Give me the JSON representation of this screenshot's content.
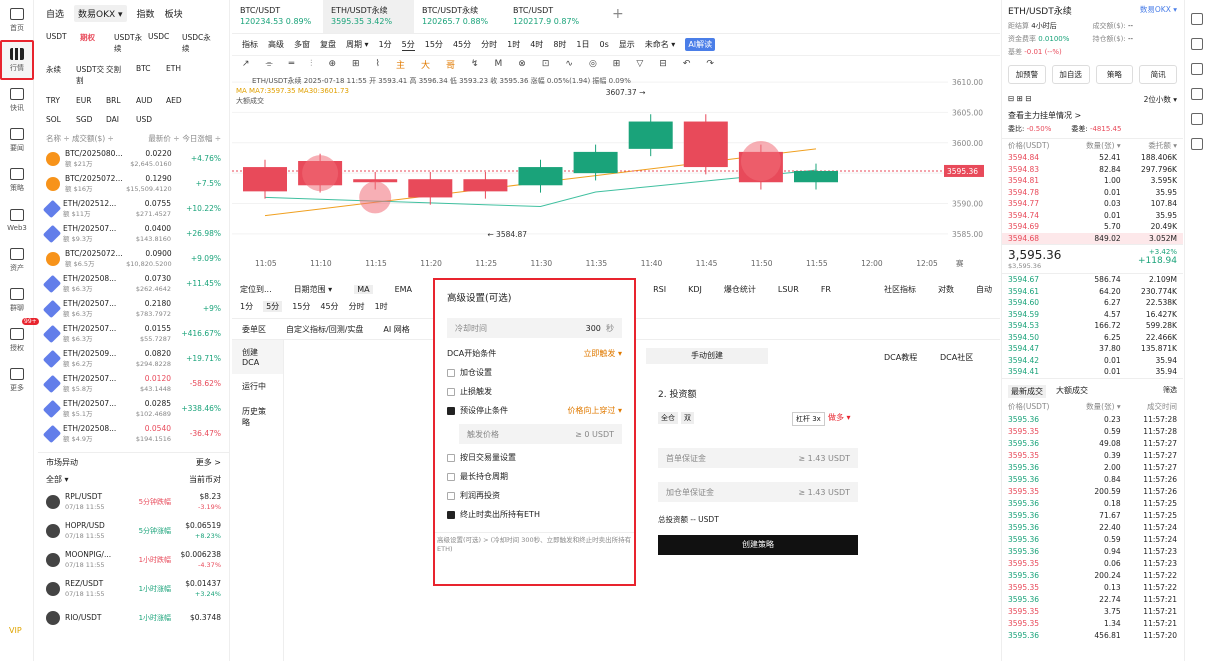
{
  "nav": [
    {
      "label": "首页"
    },
    {
      "label": "行情"
    },
    {
      "label": "快讯"
    },
    {
      "label": "要闻"
    },
    {
      "label": "策略"
    },
    {
      "label": "Web3"
    },
    {
      "label": "资产"
    },
    {
      "label": "群聊"
    },
    {
      "label": "授权"
    },
    {
      "label": "更多"
    }
  ],
  "nav_vip": "VIP",
  "nav_badge": "99+",
  "market": {
    "tabs": [
      "自选",
      "数易OKX ▾",
      "指数",
      "板块"
    ],
    "chips": [
      "USDT",
      "期权",
      "USDT永续",
      "USDC",
      "USDC永续",
      "永续",
      "USDT交割",
      "交割",
      "BTC",
      "ETH",
      "TRY",
      "EUR",
      "BRL",
      "AUD",
      "AED",
      "SOL",
      "SGD",
      "DAI",
      "USD"
    ],
    "cols": [
      "名称 ÷ 成交额($) ÷",
      "最新价 ÷",
      "今日涨幅 ÷"
    ],
    "rows": [
      {
        "n": "BTC/2025080...",
        "v": "额 $21万",
        "p": "0.0220",
        "p2": "$2,645.0160",
        "c": "+4.76%",
        "coin": "btc"
      },
      {
        "n": "BTC/2025072...",
        "v": "额 $16万",
        "p": "0.1290",
        "p2": "$15,509.4120",
        "c": "+7.5%",
        "coin": "btc"
      },
      {
        "n": "ETH/202512...",
        "v": "额 $11万",
        "p": "0.0755",
        "p2": "$271.4527",
        "c": "+10.22%",
        "coin": "eth"
      },
      {
        "n": "ETH/202507...",
        "v": "额 $9.3万",
        "p": "0.0400",
        "p2": "$143.8160",
        "c": "+26.98%",
        "coin": "eth"
      },
      {
        "n": "BTC/2025072...",
        "v": "额 $6.5万",
        "p": "0.0900",
        "p2": "$10,820.5200",
        "c": "+9.09%",
        "coin": "btc"
      },
      {
        "n": "ETH/202508...",
        "v": "额 $6.3万",
        "p": "0.0730",
        "p2": "$262.4642",
        "c": "+11.45%",
        "coin": "eth"
      },
      {
        "n": "ETH/202507...",
        "v": "额 $6.3万",
        "p": "0.2180",
        "p2": "$783.7972",
        "c": "+9%",
        "coin": "eth"
      },
      {
        "n": "ETH/202507...",
        "v": "额 $6.3万",
        "p": "0.0155",
        "p2": "$55.7287",
        "c": "+416.67%",
        "coin": "eth"
      },
      {
        "n": "ETH/202509...",
        "v": "额 $6.2万",
        "p": "0.0820",
        "p2": "$294.8228",
        "c": "+19.71%",
        "coin": "eth"
      },
      {
        "n": "ETH/202507...",
        "v": "额 $5.8万",
        "p": "0.0120",
        "p2": "$43.1448",
        "c": "-58.62%",
        "coin": "eth"
      },
      {
        "n": "ETH/202507...",
        "v": "额 $5.1万",
        "p": "0.0285",
        "p2": "$102.4689",
        "c": "+338.46%",
        "coin": "eth"
      },
      {
        "n": "ETH/202508...",
        "v": "额 $4.9万",
        "p": "0.0540",
        "p2": "$194.1516",
        "c": "-36.47%",
        "coin": "eth"
      }
    ],
    "movers_title": "市场异动",
    "movers_more": "更多 >",
    "movers_filter": "全部 ▾",
    "movers_cur": "当前币对",
    "movers": [
      {
        "n": "RPL/USDT",
        "t": "07/18 11:55",
        "e": "5分钟跌幅",
        "p": "$8.23",
        "c": "-3.19%"
      },
      {
        "n": "HOPR/USD",
        "t": "07/18 11:55",
        "e": "5分钟涨幅",
        "p": "$0.06519",
        "c": "+8.23%"
      },
      {
        "n": "MOONPIG/...",
        "t": "07/18 11:55",
        "e": "1小时跌幅",
        "p": "$0.006238",
        "c": "-4.37%"
      },
      {
        "n": "REZ/USDT",
        "t": "07/18 11:55",
        "e": "1小时涨幅",
        "p": "$0.01437",
        "c": "+3.24%"
      },
      {
        "n": "RIO/USDT",
        "t": "",
        "e": "1小时涨幅",
        "p": "$0.3748",
        "c": ""
      }
    ]
  },
  "toptabs": [
    {
      "n": "BTC/USDT",
      "v": "120234.53 0.89%"
    },
    {
      "n": "ETH/USDT永续",
      "v": "3595.35 3.42%"
    },
    {
      "n": "BTC/USDT永续",
      "v": "120265.7 0.88%"
    },
    {
      "n": "BTC/USDT",
      "v": "120217.9 0.87%"
    }
  ],
  "toolbar": [
    "指标",
    "高级",
    "多窗",
    "复盘",
    "周期 ▾",
    "1分",
    "5分",
    "15分",
    "45分",
    "分时",
    "1时",
    "4时",
    "8时",
    "1日",
    "0s",
    "显示",
    "未命名 ▾",
    "AI解读"
  ],
  "drawtools": [
    "↗",
    "⌯",
    "═",
    "⫶",
    "⊕",
    "⊞",
    "⌇",
    "主",
    "大",
    "哥",
    "↯",
    "M",
    "⊗",
    "⊡",
    "∿",
    "◎",
    "⊞",
    "▽",
    "⊟",
    "↶",
    "↷"
  ],
  "chart_info": "ETH/USDT永续 2025-07-18 11:55 开 3593.41 高 3596.34 低 3593.23 收 3595.36 涨幅 0.05%(1.94) 振幅 0.09%",
  "chart_ma": "MA MA7:3597.35 MA30:3601.73",
  "chart_lbl3": "大额成交",
  "chart_data": {
    "type": "candlestick",
    "x": [
      "11:05",
      "11:10",
      "11:15",
      "11:20",
      "11:25",
      "11:30",
      "11:35",
      "11:40",
      "11:45",
      "11:50",
      "11:55",
      "12:00",
      "12:05"
    ],
    "ylim": [
      3583,
      3611
    ],
    "yticks": [
      "3610.00",
      "3605.00",
      "3600.00",
      "3595.00",
      "3590.00",
      "3585.00"
    ],
    "candles": [
      {
        "o": 3596,
        "c": 3592
      },
      {
        "o": 3597,
        "c": 3593
      },
      {
        "o": 3594,
        "c": 3593.5
      },
      {
        "o": 3594,
        "c": 3591
      },
      {
        "o": 3594,
        "c": 3592
      },
      {
        "o": 3593,
        "c": 3596
      },
      {
        "o": 3595,
        "c": 3598.5
      },
      {
        "o": 3599,
        "c": 3603.5
      },
      {
        "o": 3603.5,
        "c": 3596
      },
      {
        "o": 3598.5,
        "c": 3593.5
      },
      {
        "o": 3593.5,
        "c": 3595.36
      }
    ],
    "max_label": "3607.37 →",
    "min_label": "← 3584.87",
    "price_tag": "3595.36",
    "unit_tag": "赛"
  },
  "ind": [
    "定位到...",
    "日期范围 ▾",
    "MA",
    "EMA",
    "ACD",
    "RSI",
    "KDJ",
    "爆仓统计",
    "LSUR",
    "FR",
    "社区指标",
    "对数",
    "自动"
  ],
  "tf2": [
    "1分",
    "5分",
    "15分",
    "45分",
    "分时",
    "1时"
  ],
  "botnav": [
    "委单区",
    "自定义指标/回测/实盘",
    "AI 网格"
  ],
  "sidenav": [
    "创建DCA",
    "运行中",
    "历史策略"
  ],
  "modal": {
    "title": "高级设置(可选)",
    "cool_lbl": "冷却时间",
    "cool_val": "300",
    "cool_unit": "秒",
    "cond_lbl": "DCA开始条件",
    "cond_val": "立即触发 ▾",
    "opts": [
      {
        "l": "加仓设置",
        "on": false
      },
      {
        "l": "止损触发",
        "on": false
      },
      {
        "l": "预设停止条件",
        "on": true,
        "x": "价格向上穿过 ▾"
      }
    ],
    "trig_lbl": "触发价格",
    "trig_val": "≥ 0 USDT",
    "opts2": [
      {
        "l": "按日交易量设置",
        "on": false
      },
      {
        "l": "最长持仓周期",
        "on": false
      },
      {
        "l": "利润再投资",
        "on": false
      },
      {
        "l": "终止时卖出所持有ETH",
        "on": true
      }
    ],
    "footer": "高级设置(可选) > (冷却时间 300秒、立即触发和终止时卖出所持有ETH)"
  },
  "dca": {
    "manual": "手动创建",
    "tutorial": "DCA教程",
    "community": "DCA社区",
    "step": "2. 投资额",
    "tag1": "全仓",
    "tag2": "双",
    "lev": "杠杆 3x",
    "dir": "做多 ▾",
    "f1": "首单保证金",
    "f1v": "≥ 1.43 USDT",
    "f2": "加仓单保证金",
    "f2v": "≥ 1.43 USDT",
    "total": "总投资额 -- USDT",
    "create": "创建策略"
  },
  "right": {
    "title": "ETH/USDT永续",
    "src": "数易OKX ▾",
    "cd_l": "距结算",
    "cd_v": "4小时后",
    "fr_l": "资金费率",
    "fr_v": "0.0100%",
    "basis_l": "基差",
    "basis_v": "-0.01 (--%)",
    "oi_l": "成交额($):",
    "oi_v": "--",
    "pos_l": "持仓额($):",
    "pos_v": "--",
    "btns": [
      "加预警",
      "加自选",
      "策略",
      "简讯"
    ],
    "depth": "2位小数 ▾",
    "big_title": "查看主力挂单情况 >",
    "bid_r_l": "委比:",
    "bid_r": "-0.50%",
    "bid_d_l": "委差:",
    "bid_d": "-4815.45",
    "ob_head": [
      "价格(USDT)",
      "数量(张) ▾",
      "委托额 ▾"
    ],
    "asks": [
      [
        "3594.84",
        "52.41",
        "188.406K"
      ],
      [
        "3594.83",
        "82.84",
        "297.796K"
      ],
      [
        "3594.81",
        "1.00",
        "3.595K"
      ],
      [
        "3594.78",
        "0.01",
        "35.95"
      ],
      [
        "3594.77",
        "0.03",
        "107.84"
      ],
      [
        "3594.74",
        "0.01",
        "35.95"
      ],
      [
        "3594.69",
        "5.70",
        "20.49K"
      ],
      [
        "3594.68",
        "849.02",
        "3.052M"
      ]
    ],
    "last": "3,595.36",
    "last_sub": "$3,595.36",
    "last_pct": "+3.42%",
    "last_chg": "+118.94",
    "bids": [
      [
        "3594.67",
        "586.74",
        "2.109M"
      ],
      [
        "3594.61",
        "64.20",
        "230.774K"
      ],
      [
        "3594.60",
        "6.27",
        "22.538K"
      ],
      [
        "3594.59",
        "4.57",
        "16.427K"
      ],
      [
        "3594.53",
        "166.72",
        "599.28K"
      ],
      [
        "3594.50",
        "6.25",
        "22.466K"
      ],
      [
        "3594.47",
        "37.80",
        "135.871K"
      ],
      [
        "3594.42",
        "0.01",
        "35.94"
      ],
      [
        "3594.41",
        "0.01",
        "35.94"
      ]
    ],
    "trades_tabs": [
      "最新成交",
      "大额成交"
    ],
    "trades_opt": "筛选",
    "trades_head": [
      "价格(USDT)",
      "数量(张) ▾",
      "成交时间"
    ],
    "trades": [
      [
        "3595.36",
        "0.23",
        "11:57:28",
        "g"
      ],
      [
        "3595.35",
        "0.59",
        "11:57:28",
        "r"
      ],
      [
        "3595.36",
        "49.08",
        "11:57:27",
        "g"
      ],
      [
        "3595.35",
        "0.39",
        "11:57:27",
        "r"
      ],
      [
        "3595.36",
        "2.00",
        "11:57:27",
        "g"
      ],
      [
        "3595.36",
        "0.84",
        "11:57:26",
        "g"
      ],
      [
        "3595.35",
        "200.59",
        "11:57:26",
        "r"
      ],
      [
        "3595.36",
        "0.18",
        "11:57:25",
        "g"
      ],
      [
        "3595.36",
        "71.67",
        "11:57:25",
        "g"
      ],
      [
        "3595.36",
        "22.40",
        "11:57:24",
        "g"
      ],
      [
        "3595.36",
        "0.59",
        "11:57:24",
        "g"
      ],
      [
        "3595.36",
        "0.94",
        "11:57:23",
        "g"
      ],
      [
        "3595.35",
        "0.06",
        "11:57:23",
        "r"
      ],
      [
        "3595.36",
        "200.24",
        "11:57:22",
        "g"
      ],
      [
        "3595.35",
        "0.13",
        "11:57:22",
        "r"
      ],
      [
        "3595.36",
        "22.74",
        "11:57:21",
        "g"
      ],
      [
        "3595.35",
        "3.75",
        "11:57:21",
        "r"
      ],
      [
        "3595.35",
        "1.34",
        "11:57:21",
        "r"
      ],
      [
        "3595.36",
        "456.81",
        "11:57:20",
        "g"
      ]
    ]
  },
  "colors": {
    "up": "#1aa37a",
    "down": "#e84a5a",
    "accent": "#e8242e"
  }
}
